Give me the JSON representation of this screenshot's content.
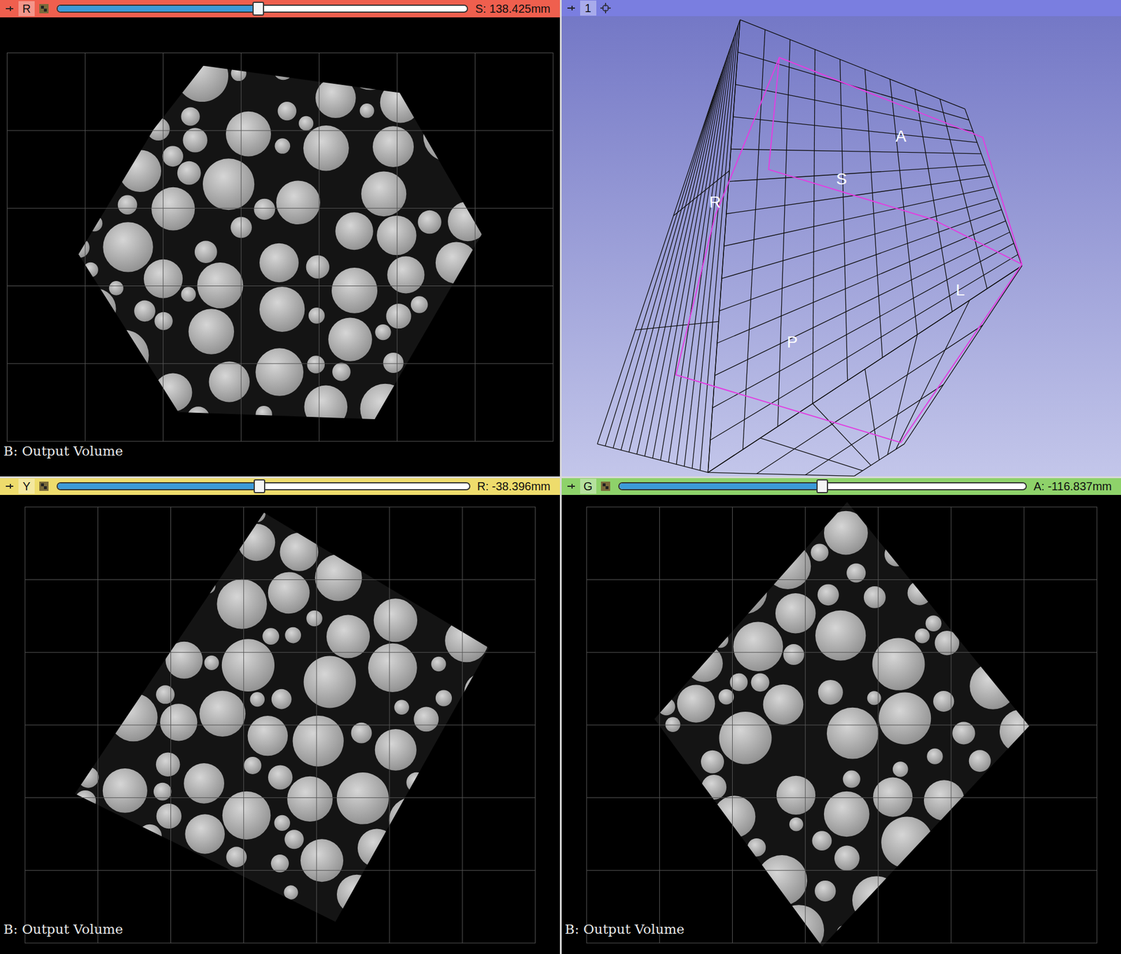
{
  "views": [
    {
      "kind": "slice",
      "label": "R",
      "color": "#ef5f4e",
      "offset": "S: 138.425mm",
      "level": 0.49,
      "volume": "B: Output Volume"
    },
    {
      "kind": "3d",
      "label": "1",
      "color": "#7a7ee0",
      "axes": [
        "A",
        "S",
        "R",
        "L",
        "P"
      ]
    },
    {
      "kind": "slice",
      "label": "Y",
      "color": "#eedc6c",
      "offset": "R: -38.396mm",
      "level": 0.49,
      "volume": "B: Output Volume"
    },
    {
      "kind": "slice",
      "label": "G",
      "color": "#8ed26a",
      "offset": "A: -116.837mm",
      "level": 0.5,
      "volume": "B: Output Volume"
    }
  ]
}
